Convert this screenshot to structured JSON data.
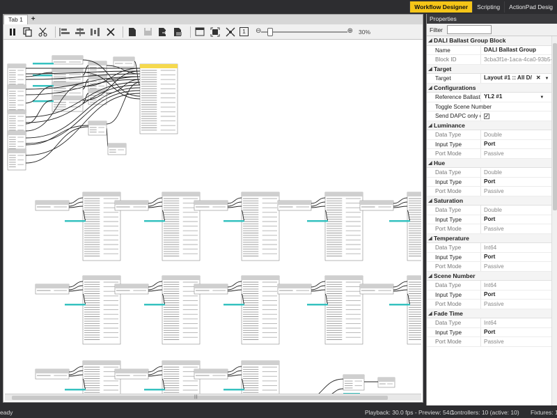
{
  "top_tabs": [
    {
      "label": "Workflow Designer",
      "active": true
    },
    {
      "label": "Scripting",
      "active": false
    },
    {
      "label": "ActionPad Desig",
      "active": false
    }
  ],
  "document": {
    "tab_label": "Tab 1",
    "plus_label": "+"
  },
  "toolbar": {
    "zoom_minus": "⊖",
    "zoom_plus": "⊕",
    "zoom_level": "30%",
    "zoom_fraction": 0.3,
    "one_to_one": "1"
  },
  "properties": {
    "header": "Properties",
    "filter_label": "Filter",
    "filter_value": "",
    "block_title": "DALI Ballast Group Block",
    "name_label": "Name",
    "name_value": "DALI Ballast Group",
    "block_id_label": "Block ID",
    "block_id_value": "3cba3f1e-1aca-4ca0-93b5-",
    "target_group": "Target",
    "target_label": "Target",
    "target_value": "Layout #1 :: All D/",
    "configurations_group": "Configurations",
    "ref_ballast_label": "Reference Ballast",
    "ref_ballast_value": "YL2 #1",
    "toggle_scene_label": "Toggle Scene Number",
    "send_dapc_label": "Send DAPC only on Lu",
    "send_dapc_checked": "✓",
    "groups": [
      {
        "name": "Luminance",
        "data_type": "Double",
        "input_type": "Port",
        "port_mode": "Passive"
      },
      {
        "name": "Hue",
        "data_type": "Double",
        "input_type": "Port",
        "port_mode": "Passive"
      },
      {
        "name": "Saturation",
        "data_type": "Double",
        "input_type": "Port",
        "port_mode": "Passive"
      },
      {
        "name": "Temperature",
        "data_type": "Int64",
        "input_type": "Port",
        "port_mode": "Passive"
      },
      {
        "name": "Scene Number",
        "data_type": "Int64",
        "input_type": "Port",
        "port_mode": "Passive"
      },
      {
        "name": "Fade Time",
        "data_type": "Int64",
        "input_type": "Port",
        "port_mode": "Passive"
      }
    ],
    "data_type_label": "Data Type",
    "input_type_label": "Input Type",
    "port_mode_label": "Port Mode"
  },
  "status": {
    "ready": "eady",
    "playback": "Playback: 30.0 fps - Preview: 54.1",
    "controllers": "Controllers: 10 (active: 10)",
    "fixtures": "Fixtures: 1"
  },
  "colors": {
    "accent": "#f5c518",
    "wire_highlight": "#36c2c0",
    "chrome": "#2d2d30"
  }
}
